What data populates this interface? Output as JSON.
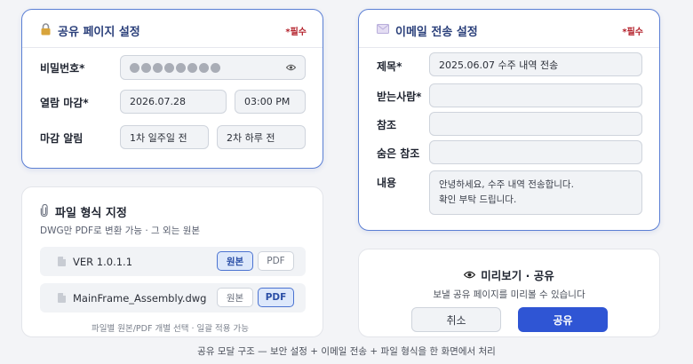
{
  "share_settings": {
    "icon": "lock-icon",
    "title": "공유 페이지 설정",
    "required": "*필수",
    "password_label": "비밀번호*",
    "password_dots": 8,
    "deadline_label": "열람 마감*",
    "deadline_date": "2026.07.28",
    "deadline_time": "03:00 PM",
    "reminder_label": "마감 알림",
    "reminder_first": "1차 일주일 전",
    "reminder_second": "2차 하루 전"
  },
  "email_settings": {
    "icon": "envelope-icon",
    "title": "이메일 전송 설정",
    "required": "*필수",
    "subject_label": "제목*",
    "subject_value": "2025.06.07 수주 내역 전송",
    "to_label": "받는사람*",
    "to_value": "",
    "cc_label": "참조",
    "cc_value": "",
    "bcc_label": "숨은 참조",
    "bcc_value": "",
    "body_label": "내용",
    "body_value": "안녕하세요, 수주 내역 전송합니다.\n확인 부탁 드립니다."
  },
  "file_format": {
    "icon": "paperclip-icon",
    "title": "파일 형식 지정",
    "subtitle": "DWG만 PDF로 변환 가능 · 그 외는 원본",
    "files": [
      {
        "name": "VER 1.0.1.1",
        "original_label": "원본",
        "pdf_label": "PDF",
        "selected": "original"
      },
      {
        "name": "MainFrame_Assembly.dwg",
        "original_label": "원본",
        "pdf_label": "PDF",
        "selected": "pdf"
      }
    ],
    "note": "파일별 원본/PDF 개별 선택 · 일괄 적용 가능"
  },
  "preview": {
    "icon": "eye-icon",
    "title": "미리보기 · 공유",
    "description": "보낼 공유 페이지를 미리볼 수 있습니다",
    "cancel_label": "취소",
    "share_label": "공유"
  },
  "footer": "공유 모달 구조 — 보안 설정 + 이메일 전송 + 파일 형식을 한 화면에서 처리",
  "colors": {
    "accent": "#2f55d4",
    "border_highlight": "#5b7fd4",
    "required": "#b3202a"
  }
}
